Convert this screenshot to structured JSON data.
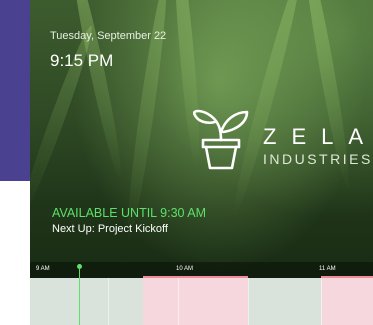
{
  "date_label": "Tuesday, September 22",
  "time_label": "9:15 PM",
  "brand": {
    "name": "ZELA",
    "subtitle": "INDUSTRIES",
    "icon": "sprout-pot-icon"
  },
  "status": {
    "availability": "AVAILABLE UNTIL 9:30 AM",
    "next_up": "Next Up: Project Kickoff",
    "available_color": "#5de06a"
  },
  "timeline": {
    "hour_labels": [
      "9 AM",
      "10 AM",
      "11 AM"
    ],
    "colors": {
      "free": "#d9e2db",
      "busy": "#f7d7de",
      "busy_edge": "#ef8d9d"
    }
  }
}
